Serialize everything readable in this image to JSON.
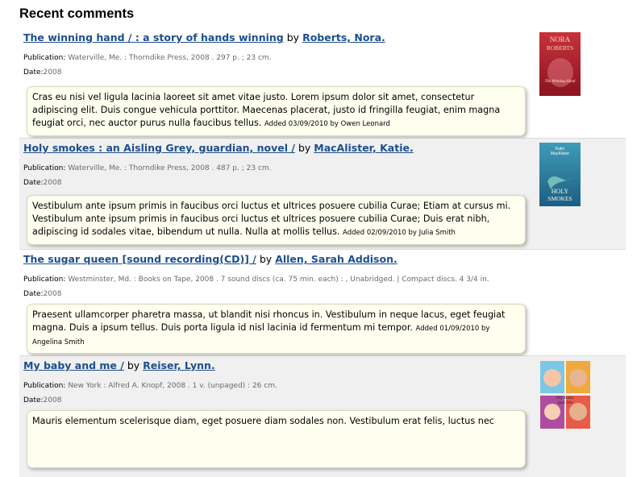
{
  "page": {
    "title": "Recent comments"
  },
  "entries": [
    {
      "title": "The winning hand / : a story of hands winning",
      "by": "by",
      "author": "Roberts, Nora.",
      "publication_label": "Publication:",
      "publication": "Waterville, Me. : Thorndike Press, 2008 . 297 p. ; 23 cm.",
      "date_label": "Date:",
      "date": "2008",
      "comment": "Cras eu nisi vel ligula lacinia laoreet sit amet vitae justo. Lorem ipsum dolor sit amet, consectetur adipiscing elit. Duis congue vehicula porttitor. Maecenas placerat, justo id fringilla feugiat, enim magna feugiat orci, nec auctor purus nulla faucibus tellus.",
      "added": "Added 03/09/2010 by Owen Leonard",
      "cover_title_a": "NORA",
      "cover_title_b": "ROBERTS",
      "cover_sub": "The Winning Hand"
    },
    {
      "title": "Holy smokes : an Aisling Grey, guardian, novel /",
      "by": "by",
      "author": "MacAlister, Katie.",
      "publication_label": "Publication:",
      "publication": "Waterville, Me. : Thorndike Press, 2008 . 487 p. ; 23 cm.",
      "date_label": "Date:",
      "date": "2008",
      "comment": "Vestibulum ante ipsum primis in faucibus orci luctus et ultrices posuere cubilia Curae; Etiam at cursus mi. Vestibulum ante ipsum primis in faucibus orci luctus et ultrices posuere cubilia Curae; Duis erat nibh, adipiscing id sodales vitae, bibendum ut nulla. Nulla at mollis tellus.",
      "added": "Added 02/09/2010 by Julia Smith",
      "cover_author_a": "Katie",
      "cover_author_b": "MacAlister",
      "cover_title_a": "HOLY",
      "cover_title_b": "SMOKES"
    },
    {
      "title": "The sugar queen [sound recording(CD)] /",
      "by": "by",
      "author": "Allen, Sarah Addison.",
      "publication_label": "Publication:",
      "publication": "Westminster, Md. : Books on Tape, 2008 . 7 sound discs (ca. 75 min. each) : , Unabridged. | Compact discs. 4 3/4 in.",
      "date_label": "Date:",
      "date": "2008",
      "comment": "Praesent ullamcorper pharetra massa, ut blandit nisi rhoncus in. Vestibulum in neque lacus, eget feugiat magna. Duis a ipsum tellus. Duis porta ligula id nisl lacinia id fermentum mi tempor.",
      "added": "Added 01/09/2010 by Angelina Smith"
    },
    {
      "title": "My baby and me /",
      "by": "by",
      "author": "Reiser, Lynn.",
      "publication_label": "Publication:",
      "publication": "New York : Alfred A. Knopf, 2008 . 1 v. (unpaged) : 26 cm.",
      "date_label": "Date:",
      "date": "2008",
      "comment": "Mauris elementum scelerisque diam, eget posuere diam sodales non. Vestibulum erat felis, luctus nec",
      "cover_title_a": "My Baby",
      "cover_title_b": "and Me"
    }
  ],
  "colors": {
    "link": "#1d4f8c",
    "alt_row": "#f0f0f0",
    "bubble": "#fffff0"
  }
}
